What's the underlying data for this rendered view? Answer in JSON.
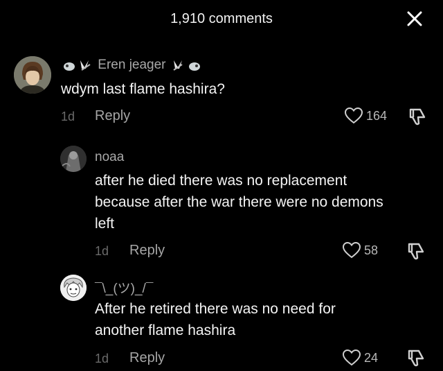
{
  "header": {
    "title": "1,910 comments",
    "close_icon": "close-icon"
  },
  "comments": [
    {
      "username": "Eren jeager",
      "text": "wdym last flame hashira?",
      "time": "1d",
      "reply_label": "Reply",
      "likes": "164"
    },
    {
      "username": "noaa",
      "text": "after he died there was no replacement\nbecause after the war there were no demons\nleft",
      "time": "1d",
      "reply_label": "Reply",
      "likes": "58"
    },
    {
      "username": "¯\\_(ツ)_/¯",
      "text": "After he retired there was no need for\nanother flame hashira",
      "time": "1d",
      "reply_label": "Reply",
      "likes": "24"
    }
  ],
  "colors": {
    "background": "#000000",
    "primary_text": "#f4f4f4",
    "secondary_text": "#a9a9a9",
    "muted_text": "#6a6a6a"
  }
}
